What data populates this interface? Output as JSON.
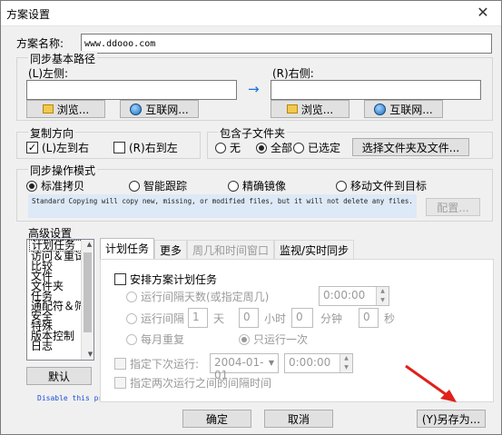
{
  "window": {
    "title": "方案设置",
    "close_label": "✕"
  },
  "scheme_name": {
    "label": "方案名称:",
    "value": "www.ddooo.com"
  },
  "sync_path": {
    "title": "同步基本路径",
    "left_label": "(L)左侧:",
    "right_label": "(R)右侧:",
    "arrow": "→",
    "browse_label": "浏览...",
    "internet_label": "互联网..."
  },
  "copy_direction": {
    "title": "复制方向",
    "left_to_right": "(L)左到右",
    "right_to_left": "(R)右到左"
  },
  "subfolders": {
    "title": "包含子文件夹",
    "none": "无",
    "all": "全部",
    "selected": "已选定",
    "select_button": "选择文件夹及文件..."
  },
  "sync_mode": {
    "title": "同步操作模式",
    "standard": "标准拷贝",
    "smart": "智能跟踪",
    "mirror": "精确镜像",
    "move": "移动文件到目标",
    "description": "Standard Copying will copy new, missing, or modified files, but it will not delete any files.",
    "config_button": "配置..."
  },
  "advanced": {
    "title": "高级设置",
    "list_items": [
      "计划任务",
      "访问＆重试",
      "比较",
      "文件",
      "文件夹",
      "任务",
      "通配符＆筛",
      "安全",
      "特殊",
      "版本控制",
      "日志"
    ],
    "default_button": "默认",
    "disable_note": "Disable this profile"
  },
  "tabs": [
    "计划任务",
    "更多",
    "周几和时间窗口",
    "监视/实时同步"
  ],
  "schedule": {
    "schedule_task": "安排方案计划任务",
    "run_interval_days": "运行间隔天数(或指定周几)",
    "interval_days_time": "0:00:00",
    "run_interval": "运行间隔",
    "interval_value": "1",
    "day_unit": "天",
    "hours_value": "0",
    "hour_unit": "小时",
    "minutes_value": "0",
    "minute_unit": "分钟",
    "seconds_value": "0",
    "second_unit": "秒",
    "daily_repeat": "每月重复",
    "run_once": "只运行一次",
    "next_run": "指定下次运行:",
    "next_run_date": "2004-01-01",
    "next_run_time": "0:00:00",
    "between_runs": "指定两次运行之间的间隔时间"
  },
  "footer": {
    "ok": "确定",
    "cancel": "取消",
    "save_as": "(Y)另存为..."
  },
  "colors": {
    "accent_arrow": "#1e6fd9",
    "annotation_arrow": "#e0201b"
  }
}
